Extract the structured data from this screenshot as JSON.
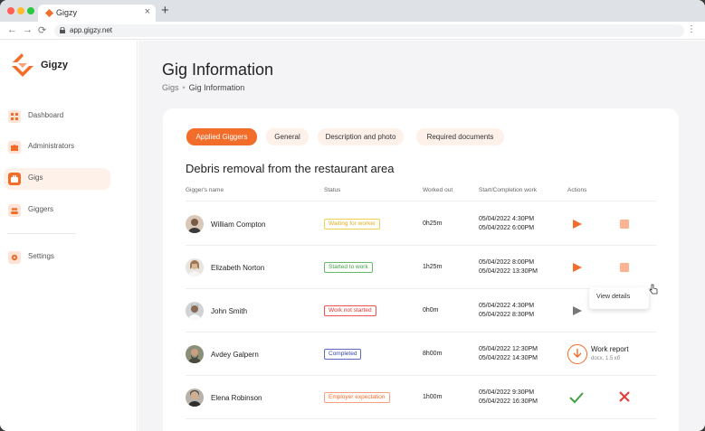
{
  "browser": {
    "tab_title": "Gigzy",
    "tab_close": "×",
    "new_tab": "+",
    "url": "app.gigzy.net",
    "back": "←",
    "forward": "→",
    "reload": "⟳",
    "menu": "⋮"
  },
  "sidebar": {
    "logo_text": "Gigzy",
    "items": [
      {
        "label": "Dashboard",
        "icon": "dashboard-icon",
        "active": false
      },
      {
        "label": "Administrators",
        "icon": "puzzle-icon",
        "active": false
      },
      {
        "label": "Gigs",
        "icon": "briefcase-icon",
        "active": true
      },
      {
        "label": "Giggers",
        "icon": "people-icon",
        "active": false
      },
      {
        "label": "Settings",
        "icon": "gear-icon",
        "active": false
      }
    ]
  },
  "main": {
    "title": "Gig Information",
    "breadcrumb": {
      "root": "Gigs",
      "separator": "•",
      "current": "Gig Information"
    },
    "tabs": [
      "Applied Giggers",
      "General",
      "Description and photo",
      "Required documents"
    ],
    "gig_title": "Debris removal from the restaurant area",
    "columns": [
      "Gigger's name",
      "Status",
      "Worked out",
      "Start/Completion work",
      "Actions"
    ],
    "rows": [
      {
        "name": "William Compton",
        "status": "Waiting for worker",
        "worked": "0h25m",
        "start": "05/04/2022 4:30PM",
        "end": "05/04/2022 6:00PM"
      },
      {
        "name": "Elizabeth Norton",
        "status": "Started to work",
        "worked": "1h25m",
        "start": "05/04/2022 8:00PM",
        "end": "05/04/2022 13:30PM"
      },
      {
        "name": "John Smith",
        "status": "Work not started",
        "worked": "0h0m",
        "start": "05/04/2022 4:30PM",
        "end": "05/04/2022 8:30PM"
      },
      {
        "name": "Avdey Galpern",
        "status": "Completed",
        "worked": "8h00m",
        "start": "05/04/2022 12:30PM",
        "end": "05/04/2022 14:30PM",
        "report_label": "Work report",
        "report_size": "docx, 1.5 кб"
      },
      {
        "name": "Elena Robinson",
        "status": "Employer expectation",
        "worked": "1h00m",
        "start": "05/04/2022 9:30PM",
        "end": "05/04/2022 16:30PM"
      }
    ],
    "tooltip": "View details"
  },
  "colors": {
    "accent": "#f26c2a",
    "accent_light": "#fdf1ea",
    "status_waiting": "#e8c42a",
    "status_started": "#4caf50",
    "status_not_started": "#e53935",
    "status_completed": "#3f51b5",
    "status_expectation": "#f26c2a"
  }
}
